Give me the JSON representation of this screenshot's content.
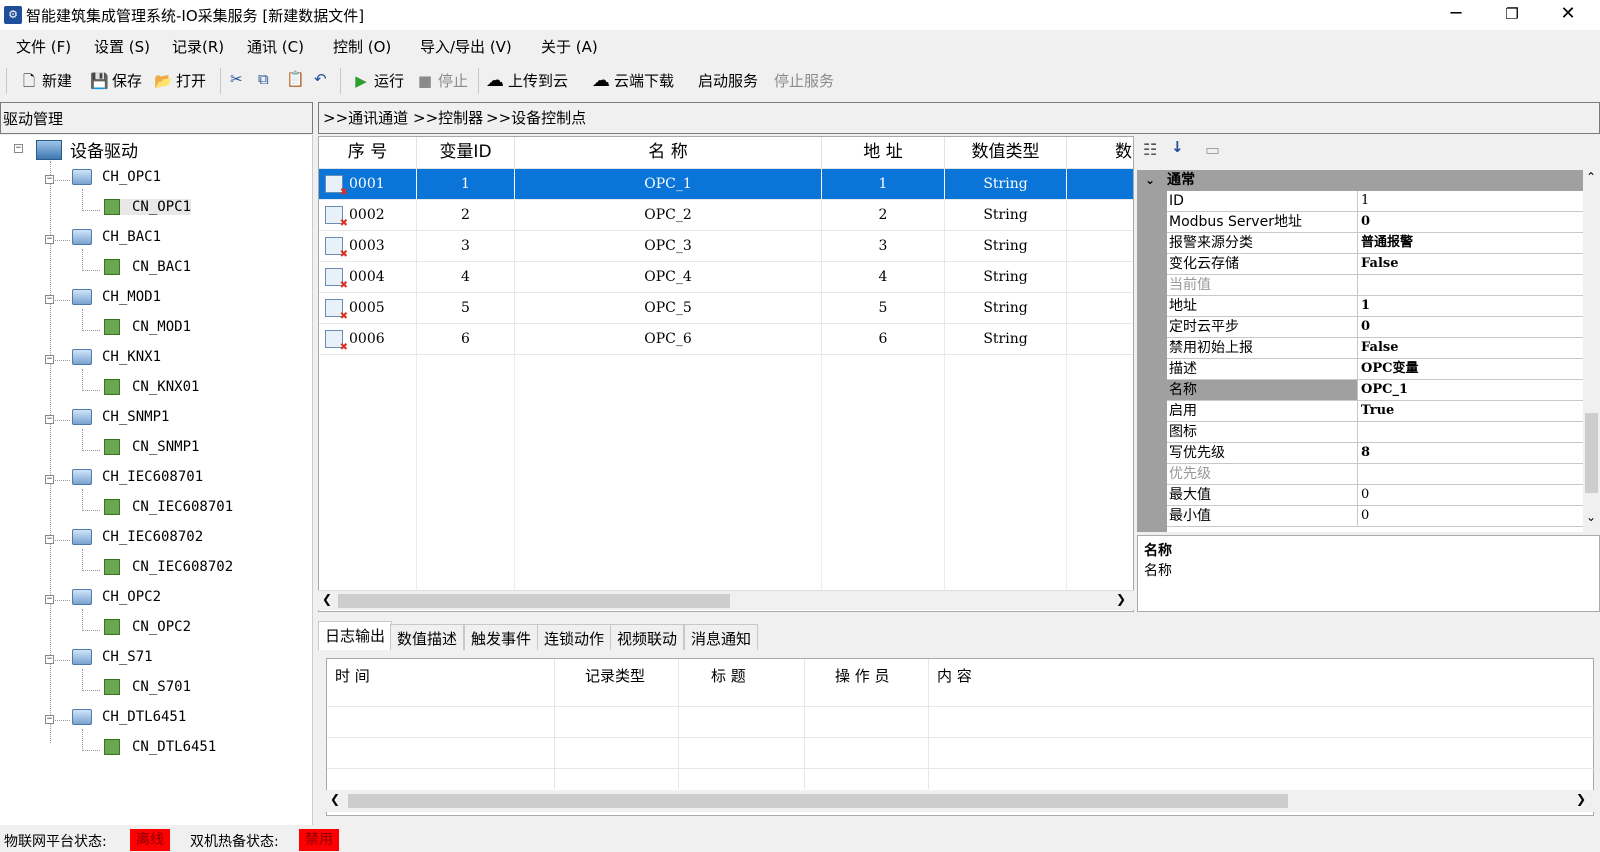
{
  "window": {
    "title": "智能建筑集成管理系统-IO采集服务 [新建数据文件]",
    "minimize": "─",
    "maximize": "❐",
    "close": "✕"
  },
  "menu": [
    "文件 (F)",
    "设置 (S)",
    "记录(R)",
    "通讯 (C)",
    "控制 (O)",
    "导入/导出 (V)",
    "关于 (A)"
  ],
  "toolbar": {
    "new": "新建",
    "save": "保存",
    "open": "打开",
    "run": "运行",
    "stop": "停止",
    "upload": "上传到云",
    "download": "云端下载",
    "start_service": "启动服务",
    "stop_service": "停止服务"
  },
  "left_panel": {
    "header": "驱动管理",
    "root": "设备驱动",
    "channels": [
      {
        "channel": "CH_OPC1",
        "controller": "CN_OPC1"
      },
      {
        "channel": "CH_BAC1",
        "controller": "CN_BAC1"
      },
      {
        "channel": "CH_MOD1",
        "controller": "CN_MOD1"
      },
      {
        "channel": "CH_KNX1",
        "controller": "CN_KNX01"
      },
      {
        "channel": "CH_SNMP1",
        "controller": "CN_SNMP1"
      },
      {
        "channel": "CH_IEC608701",
        "controller": "CN_IEC608701"
      },
      {
        "channel": "CH_IEC608702",
        "controller": "CN_IEC608702"
      },
      {
        "channel": "CH_OPC2",
        "controller": "CN_OPC2"
      },
      {
        "channel": "CH_S71",
        "controller": "CN_S701"
      },
      {
        "channel": "CH_DTL6451",
        "controller": "CN_DTL6451"
      }
    ]
  },
  "breadcrumb": [
    ">>通讯通道",
    ">>控制器",
    ">>设备控制点"
  ],
  "grid": {
    "headers": [
      "序  号",
      "变量ID",
      "名  称",
      "地  址",
      "数值类型",
      "数"
    ],
    "rows": [
      {
        "seq": "0001",
        "id": "1",
        "name": "OPC_1",
        "addr": "1",
        "type": "String"
      },
      {
        "seq": "0002",
        "id": "2",
        "name": "OPC_2",
        "addr": "2",
        "type": "String"
      },
      {
        "seq": "0003",
        "id": "3",
        "name": "OPC_3",
        "addr": "3",
        "type": "String"
      },
      {
        "seq": "0004",
        "id": "4",
        "name": "OPC_4",
        "addr": "4",
        "type": "String"
      },
      {
        "seq": "0005",
        "id": "5",
        "name": "OPC_5",
        "addr": "5",
        "type": "String"
      },
      {
        "seq": "0006",
        "id": "6",
        "name": "OPC_6",
        "addr": "6",
        "type": "String"
      }
    ]
  },
  "properties": {
    "category": "通常",
    "items": [
      {
        "name": "ID",
        "value": "1"
      },
      {
        "name": "Modbus Server地址",
        "value": "0"
      },
      {
        "name": "报警来源分类",
        "value": "普通报警"
      },
      {
        "name": "变化云存储",
        "value": "False"
      },
      {
        "name": "当前值",
        "value": ""
      },
      {
        "name": "地址",
        "value": "1"
      },
      {
        "name": "定时云平步",
        "value": "0"
      },
      {
        "name": "禁用初始上报",
        "value": "False"
      },
      {
        "name": "描述",
        "value": "OPC变量"
      },
      {
        "name": "名称",
        "value": "OPC_1"
      },
      {
        "name": "启用",
        "value": "True"
      },
      {
        "name": "图标",
        "value": ""
      },
      {
        "name": "写优先级",
        "value": "8"
      },
      {
        "name": "优先级",
        "value": ""
      },
      {
        "name": "最大值",
        "value": "0"
      },
      {
        "name": "最小值",
        "value": "0"
      }
    ],
    "desc_title": "名称",
    "desc_text": "名称"
  },
  "tabs": [
    "日志输出",
    "数值描述",
    "触发事件",
    "连锁动作",
    "视频联动",
    "消息通知"
  ],
  "log": {
    "headers": [
      "时    间",
      "记录类型",
      "标    题",
      "操 作 员",
      "内    容"
    ]
  },
  "status": {
    "iot_label": "物联网平台状态:",
    "iot_value": "离线",
    "ha_label": "双机热备状态:",
    "ha_value": "禁用"
  },
  "colors": {
    "selection": "#0a74d8",
    "status_alert": "#ff0000",
    "category_gray": "#a0a0a0"
  }
}
